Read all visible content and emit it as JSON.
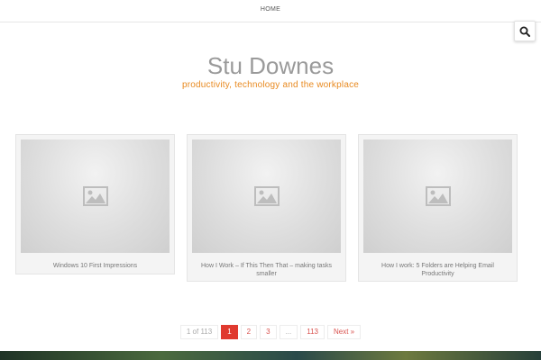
{
  "nav": {
    "home_label": "HOME"
  },
  "header": {
    "site_title": "Stu Downes",
    "tagline": "productivity, technology and the workplace"
  },
  "posts": [
    {
      "title": "Windows 10 First Impressions",
      "thumb_icon": "image-placeholder-icon"
    },
    {
      "title": "How I Work – If This Then That – making tasks smaller",
      "thumb_icon": "image-placeholder-icon"
    },
    {
      "title": "How I work: 5 Folders are Helping Email Productivity",
      "thumb_icon": "image-placeholder-icon"
    }
  ],
  "pagination": {
    "summary": "1 of 113",
    "pages": [
      "1",
      "2",
      "3"
    ],
    "ellipsis": "...",
    "last": "113",
    "next": "Next »",
    "current": "1"
  },
  "colors": {
    "tagline": "#e8891f",
    "current_page": "#e03a2f",
    "title": "#9a9a9a"
  },
  "icons": {
    "search": "search-icon"
  }
}
